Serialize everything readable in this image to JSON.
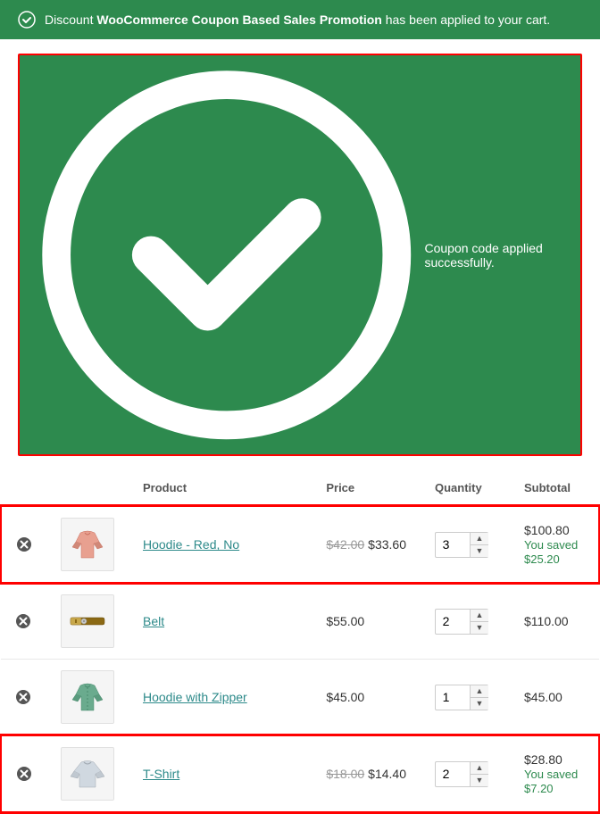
{
  "notifications": {
    "discount_msg_prefix": "Discount ",
    "discount_msg_bold": "WooCommerce Coupon Based Sales Promotion",
    "discount_msg_suffix": " has been applied to your cart.",
    "coupon_success": "Coupon code applied successfully."
  },
  "table": {
    "headers": {
      "product": "Product",
      "price": "Price",
      "quantity": "Quantity",
      "subtotal": "Subtotal"
    },
    "rows": [
      {
        "id": "hoodie-red",
        "name": "Hoodie - Red, No",
        "price_old": "$42.00",
        "price_new": "$33.60",
        "qty": 3,
        "subtotal": "$100.80",
        "saved": "You saved $25.20",
        "highlighted": true,
        "img_type": "hoodie-red"
      },
      {
        "id": "belt",
        "name": "Belt",
        "price_old": null,
        "price_new": "$55.00",
        "qty": 2,
        "subtotal": "$110.00",
        "saved": null,
        "highlighted": false,
        "img_type": "belt"
      },
      {
        "id": "hoodie-zipper",
        "name": "Hoodie with Zipper",
        "price_old": null,
        "price_new": "$45.00",
        "qty": 1,
        "subtotal": "$45.00",
        "saved": null,
        "highlighted": false,
        "img_type": "hoodie-green"
      },
      {
        "id": "tshirt",
        "name": "T-Shirt",
        "price_old": "$18.00",
        "price_new": "$14.40",
        "qty": 2,
        "subtotal": "$28.80",
        "saved": "You saved $7.20",
        "highlighted": true,
        "img_type": "tshirt"
      }
    ]
  }
}
